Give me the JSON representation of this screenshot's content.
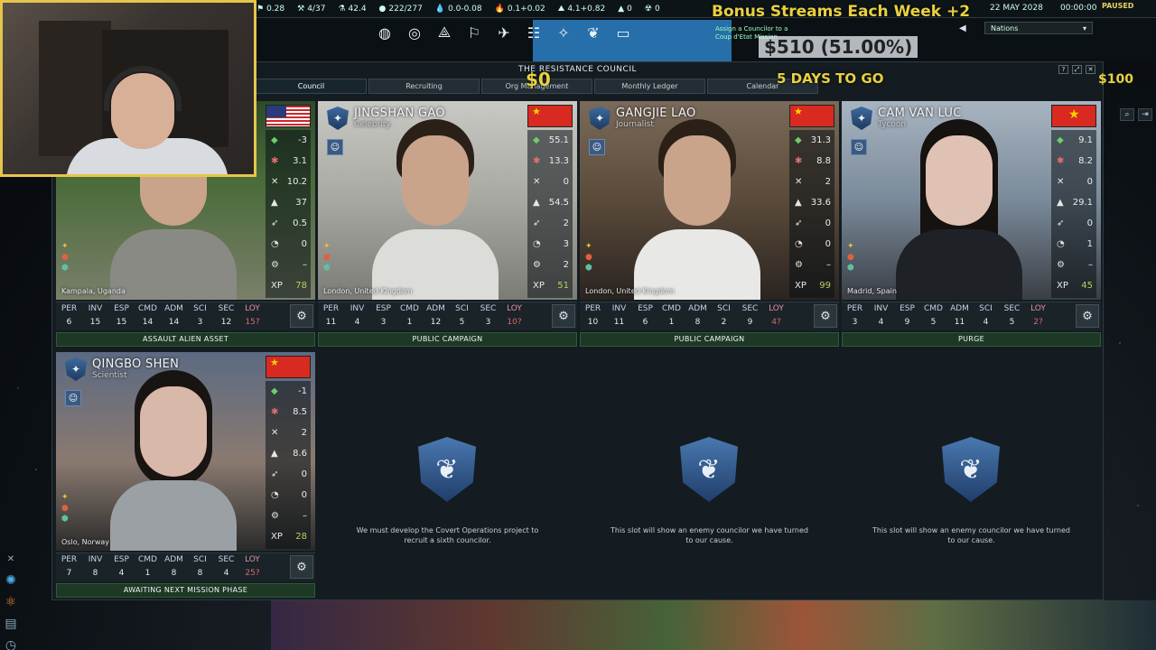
{
  "topbar": {
    "resources": [
      {
        "icon": "flag-icon",
        "glyph": "⚑",
        "value": "0.28"
      },
      {
        "icon": "control-icon",
        "glyph": "⚒",
        "value": "4/37"
      },
      {
        "icon": "research-icon",
        "glyph": "⚗",
        "value": "42.4"
      },
      {
        "icon": "ops-icon",
        "glyph": "●",
        "value": "222/277"
      },
      {
        "icon": "water-icon",
        "glyph": "💧",
        "value": "0.0-0.08"
      },
      {
        "icon": "volatiles-icon",
        "glyph": "🔥",
        "value": "0.1+0.02"
      },
      {
        "icon": "metals-icon",
        "glyph": "⛰",
        "value": "4.1+0.82"
      },
      {
        "icon": "noble-metals-icon",
        "glyph": "▲",
        "value": "0"
      },
      {
        "icon": "fissiles-icon",
        "glyph": "☢",
        "value": "0"
      }
    ],
    "date": "22 MAY 2028",
    "clock": "00:00:00",
    "paused": "PAUSED",
    "nations": "Nations"
  },
  "actionbar": {
    "icons": [
      "globe-icon",
      "target-icon",
      "network-icon",
      "flag-wave-icon",
      "missile-icon",
      "sliders-icon",
      "bulb-icon",
      "brain-icon",
      "monitor-icon"
    ],
    "assign_text": "Assign a Councilor to a Coup d'Etat Mission"
  },
  "overlay": {
    "bonus": "Bonus Streams Each Week +2",
    "money": "$510 (51.00%)",
    "zero": "$0",
    "days": "5 DAYS TO GO",
    "right": "$100"
  },
  "window": {
    "title": "THE RESISTANCE COUNCIL",
    "tabs": [
      "Council",
      "Recruiting",
      "Org Management",
      "Monthly Ledger",
      "Calendar"
    ],
    "active_tab": 0
  },
  "attr_headers": [
    "PER",
    "INV",
    "ESP",
    "CMD",
    "ADM",
    "SCI",
    "SEC",
    "LOY"
  ],
  "councilors": [
    {
      "name": "",
      "role": "",
      "location": "Kampala, Uganda",
      "flag": "us",
      "stats": [
        "-3",
        "3.1",
        "10.2",
        "37",
        "0.5",
        "0",
        "–"
      ],
      "xp": "78",
      "attrs": [
        "6",
        "15",
        "15",
        "14",
        "14",
        "3",
        "12",
        "15?"
      ],
      "mission": "ASSAULT ALIEN ASSET"
    },
    {
      "name": "JINGSHAN GAO",
      "role": "Celebrity",
      "location": "London, United Kingdom",
      "flag": "cn",
      "stats": [
        "55.1",
        "13.3",
        "0",
        "54.5",
        "2",
        "3",
        "2"
      ],
      "xp": "51",
      "attrs": [
        "11",
        "4",
        "3",
        "1",
        "12",
        "5",
        "3",
        "10?"
      ],
      "mission": "PUBLIC CAMPAIGN"
    },
    {
      "name": "GANGJIE LAO",
      "role": "Journalist",
      "location": "London, United Kingdom",
      "flag": "cn",
      "stats": [
        "31.3",
        "8.8",
        "2",
        "33.6",
        "0",
        "0",
        "–"
      ],
      "xp": "99",
      "attrs": [
        "10",
        "11",
        "6",
        "1",
        "8",
        "2",
        "9",
        "4?"
      ],
      "mission": "PUBLIC CAMPAIGN"
    },
    {
      "name": "CAM VAN LUC",
      "role": "Tycoon",
      "location": "Madrid, Spain",
      "flag": "vn",
      "stats": [
        "9.1",
        "8.2",
        "0",
        "29.1",
        "0",
        "1",
        "–"
      ],
      "xp": "45",
      "attrs": [
        "3",
        "4",
        "9",
        "5",
        "11",
        "4",
        "5",
        "2?"
      ],
      "mission": "PURGE"
    },
    {
      "name": "QINGBO SHEN",
      "role": "Scientist",
      "location": "Oslo, Norway",
      "flag": "cn",
      "stats": [
        "-1",
        "8.5",
        "2",
        "8.6",
        "0",
        "0",
        "–"
      ],
      "xp": "28",
      "attrs": [
        "7",
        "8",
        "4",
        "1",
        "8",
        "8",
        "4",
        "25?"
      ],
      "mission": "AWAITING NEXT MISSION PHASE"
    }
  ],
  "stat_icons": [
    {
      "name": "influence-icon",
      "glyph": "◆",
      "color": "#6ad06a"
    },
    {
      "name": "ops-person-icon",
      "glyph": "✱",
      "color": "#e07070"
    },
    {
      "name": "boost-icon",
      "glyph": "✕",
      "color": "#e6e6e6"
    },
    {
      "name": "research-flask-icon",
      "glyph": "▲",
      "color": "#e6e6e6"
    },
    {
      "name": "rocket-icon",
      "glyph": "➶",
      "color": "#e6e6e6"
    },
    {
      "name": "mission-control-icon",
      "glyph": "◔",
      "color": "#e6e6e6"
    },
    {
      "name": "projects-icon",
      "glyph": "⚙",
      "color": "#e6e6e6"
    }
  ],
  "xp_label": "XP",
  "empty_slots": [
    {
      "text": "We must develop the Covert Operations project to recruit a sixth councilor."
    },
    {
      "text": "This slot will show an enemy councilor we have turned to our cause."
    },
    {
      "text": "This slot will show an enemy councilor we have turned to our cause."
    }
  ]
}
